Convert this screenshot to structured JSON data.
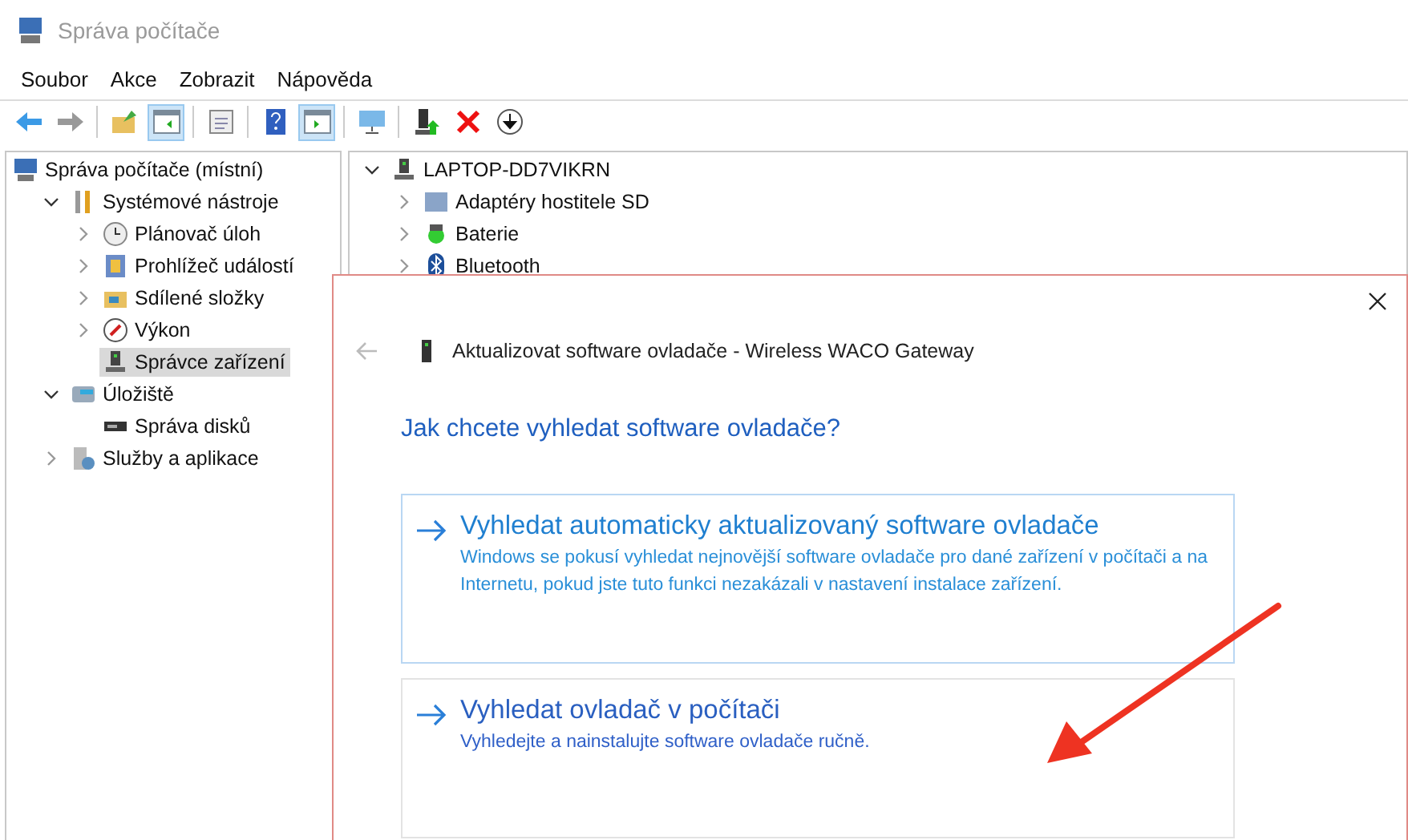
{
  "window": {
    "title": "Správa počítače"
  },
  "menu": [
    "Soubor",
    "Akce",
    "Zobrazit",
    "Nápověda"
  ],
  "toolbar": [
    {
      "kind": "back",
      "pressed": false
    },
    {
      "kind": "forward",
      "pressed": false
    },
    {
      "kind": "sep"
    },
    {
      "kind": "up",
      "pressed": false
    },
    {
      "kind": "panel",
      "pressed": true
    },
    {
      "kind": "sep"
    },
    {
      "kind": "sheet",
      "pressed": false
    },
    {
      "kind": "sep"
    },
    {
      "kind": "help",
      "pressed": false
    },
    {
      "kind": "panel2",
      "pressed": true
    },
    {
      "kind": "sep"
    },
    {
      "kind": "monitor",
      "pressed": false
    },
    {
      "kind": "sep"
    },
    {
      "kind": "device",
      "pressed": false
    },
    {
      "kind": "delete",
      "pressed": false
    },
    {
      "kind": "download",
      "pressed": false
    }
  ],
  "left_tree": [
    {
      "label": "Správa počítače (místní)",
      "kind": "computer",
      "selected": false,
      "children": [
        {
          "label": "Systémové nástroje",
          "kind": "tools",
          "expanded": true,
          "selected": false,
          "children": [
            {
              "label": "Plánovač úloh",
              "kind": "clock",
              "expanded": false,
              "selected": false
            },
            {
              "label": "Prohlížeč událostí",
              "kind": "event",
              "expanded": false,
              "selected": false
            },
            {
              "label": "Sdílené složky",
              "kind": "share",
              "expanded": false,
              "selected": false
            },
            {
              "label": "Výkon",
              "kind": "perf",
              "expanded": false,
              "selected": false
            },
            {
              "label": "Správce zařízení",
              "kind": "device",
              "selected": true
            }
          ]
        },
        {
          "label": "Úložiště",
          "kind": "storage",
          "expanded": true,
          "selected": false,
          "children": [
            {
              "label": "Správa disků",
              "kind": "disk",
              "selected": false
            }
          ]
        },
        {
          "label": "Služby a aplikace",
          "kind": "services",
          "expanded": false,
          "selected": false
        }
      ]
    }
  ],
  "device_tree": [
    {
      "label": "LAPTOP-DD7VIKRN",
      "kind": "device",
      "expanded": true,
      "children": [
        {
          "label": "Adaptéry hostitele SD",
          "kind": "adapter",
          "expanded": false
        },
        {
          "label": "Baterie",
          "kind": "battery",
          "expanded": false
        },
        {
          "label": "Bluetooth",
          "kind": "bluetooth",
          "expanded": false
        }
      ]
    }
  ],
  "dialog": {
    "title": "Aktualizovat software ovladače - Wireless WACO Gateway",
    "heading": "Jak chcete vyhledat software ovladače?",
    "options": [
      {
        "title": "Vyhledat automaticky aktualizovaný software ovladače",
        "description": "Windows se pokusí vyhledat nejnovější software ovladače pro dané zařízení v počítači a na Internetu, pokud jste tuto funkci nezakázali v nastavení instalace zařízení.",
        "highlighted": true
      },
      {
        "title": "Vyhledat ovladač v počítači",
        "description": "Vyhledejte a nainstalujte software ovladače ručně.",
        "highlighted": false
      }
    ]
  }
}
